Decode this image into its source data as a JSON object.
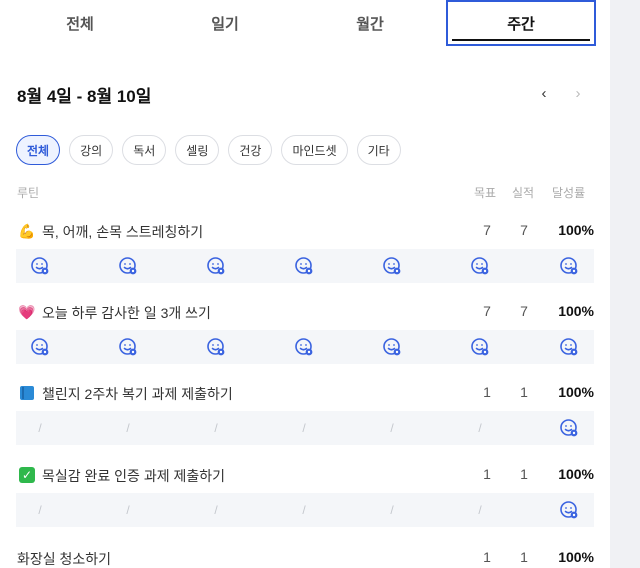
{
  "tabs": [
    {
      "label": "전체",
      "active": false
    },
    {
      "label": "일기",
      "active": false
    },
    {
      "label": "월간",
      "active": false
    },
    {
      "label": "주간",
      "active": true
    }
  ],
  "week": {
    "title": "8월 4일 - 8월 10일",
    "prev": "‹",
    "next": "›"
  },
  "categories": [
    {
      "label": "전체",
      "active": true
    },
    {
      "label": "강의",
      "active": false
    },
    {
      "label": "독서",
      "active": false
    },
    {
      "label": "셀링",
      "active": false
    },
    {
      "label": "건강",
      "active": false
    },
    {
      "label": "마인드셋",
      "active": false
    },
    {
      "label": "기타",
      "active": false
    }
  ],
  "columns": {
    "routine": "루틴",
    "goal": "목표",
    "actual": "실적",
    "rate": "달성률"
  },
  "routines": [
    {
      "icon": "flexed-biceps",
      "emoji": "💪",
      "name": "목, 어깨, 손목 스트레칭하기",
      "goal": "7",
      "actual": "7",
      "rate": "100%",
      "days": [
        "done",
        "done",
        "done",
        "done",
        "done",
        "done",
        "done"
      ]
    },
    {
      "icon": "pink-heart",
      "emoji": "💗",
      "name": "오늘 하루 감사한 일 3개 쓰기",
      "goal": "7",
      "actual": "7",
      "rate": "100%",
      "days": [
        "done",
        "done",
        "done",
        "done",
        "done",
        "done",
        "done"
      ]
    },
    {
      "icon": "blue-book",
      "emoji": "",
      "name": "챌린지 2주차 복기 과제 제출하기",
      "goal": "1",
      "actual": "1",
      "rate": "100%",
      "days": [
        "none",
        "none",
        "none",
        "none",
        "none",
        "none",
        "done"
      ]
    },
    {
      "icon": "check-mark-button",
      "emoji": "✓",
      "name": "목실감 완료 인증 과제 제출하기",
      "goal": "1",
      "actual": "1",
      "rate": "100%",
      "days": [
        "none",
        "none",
        "none",
        "none",
        "none",
        "none",
        "done"
      ]
    },
    {
      "icon": "",
      "emoji": "",
      "name": "화장실 청소하기",
      "goal": "1",
      "actual": "1",
      "rate": "100%",
      "days": []
    }
  ],
  "glyphs": {
    "slash": "/"
  },
  "colors": {
    "accent": "#2f5bd9",
    "face": "#3a63e0",
    "strip": "#f4f6f9",
    "check_green": "#2fb84c",
    "book_blue": "#2a8ad6"
  }
}
